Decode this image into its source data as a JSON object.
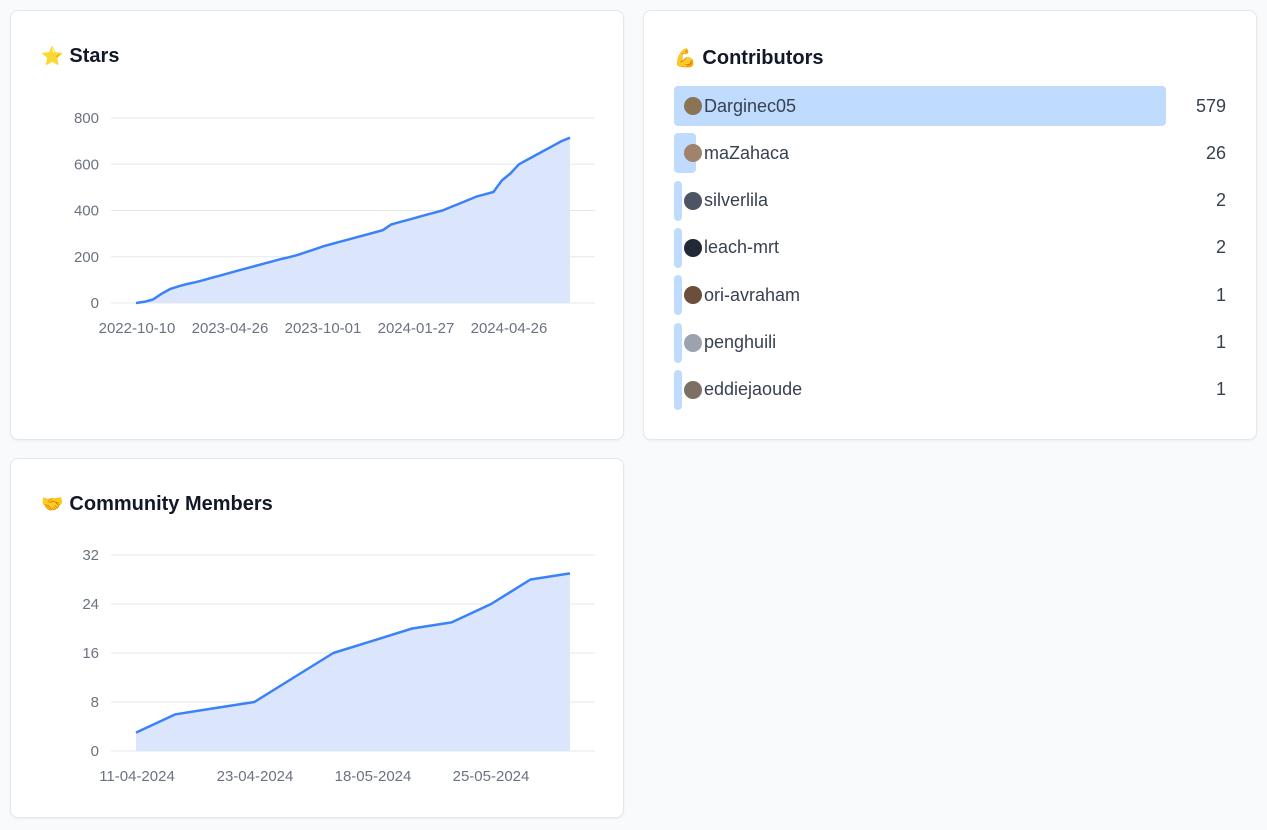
{
  "cards": {
    "stars": {
      "emoji": "⭐",
      "title": "Stars"
    },
    "contributors": {
      "emoji": "💪",
      "title": "Contributors"
    },
    "community": {
      "emoji": "🤝",
      "title": "Community Members"
    }
  },
  "contributors": [
    {
      "name": "Darginec05",
      "count": 579,
      "avatar_color": "#8b7355"
    },
    {
      "name": "maZahaca",
      "count": 26,
      "avatar_color": "#a0826d"
    },
    {
      "name": "silverlila",
      "count": 2,
      "avatar_color": "#4b5563"
    },
    {
      "name": "leach-mrt",
      "count": 2,
      "avatar_color": "#1f2937"
    },
    {
      "name": "ori-avraham",
      "count": 1,
      "avatar_color": "#6b4f3a"
    },
    {
      "name": "penghuili",
      "count": 1,
      "avatar_color": "#9ca3af"
    },
    {
      "name": "eddiejaoude",
      "count": 1,
      "avatar_color": "#7c6f64"
    }
  ],
  "colors": {
    "line": "#3b82f6",
    "area": "#dbe6fd",
    "grid": "#e5e7eb",
    "tick_text": "#6b7280"
  },
  "chart_data": [
    {
      "id": "stars",
      "type": "area",
      "title": "Stars",
      "x_tick_labels": [
        "2022-10-10",
        "2023-04-26",
        "2023-10-01",
        "2024-01-27",
        "2024-04-26"
      ],
      "yticks": [
        0,
        200,
        400,
        600,
        800
      ],
      "ylim": [
        0,
        800
      ],
      "grid": true,
      "series": [
        {
          "values": [
            0,
            5,
            15,
            40,
            60,
            72,
            82,
            90,
            100,
            110,
            120,
            130,
            140,
            150,
            160,
            170,
            180,
            190,
            198,
            208,
            220,
            232,
            245,
            255,
            265,
            275,
            285,
            295,
            305,
            315,
            340,
            350,
            360,
            370,
            380,
            390,
            400,
            415,
            430,
            445,
            460,
            470,
            480,
            530,
            560,
            600,
            620,
            640,
            660,
            680,
            700,
            715
          ]
        }
      ]
    },
    {
      "id": "community",
      "type": "area",
      "title": "Community Members",
      "x_tick_labels": [
        "11-04-2024",
        "23-04-2024",
        "18-05-2024",
        "25-05-2024"
      ],
      "yticks": [
        0,
        8,
        16,
        24,
        32
      ],
      "ylim": [
        0,
        32
      ],
      "grid": true,
      "series": [
        {
          "values": [
            3,
            6,
            7,
            8,
            12,
            16,
            18,
            20,
            21,
            24,
            28,
            29
          ]
        }
      ]
    }
  ]
}
